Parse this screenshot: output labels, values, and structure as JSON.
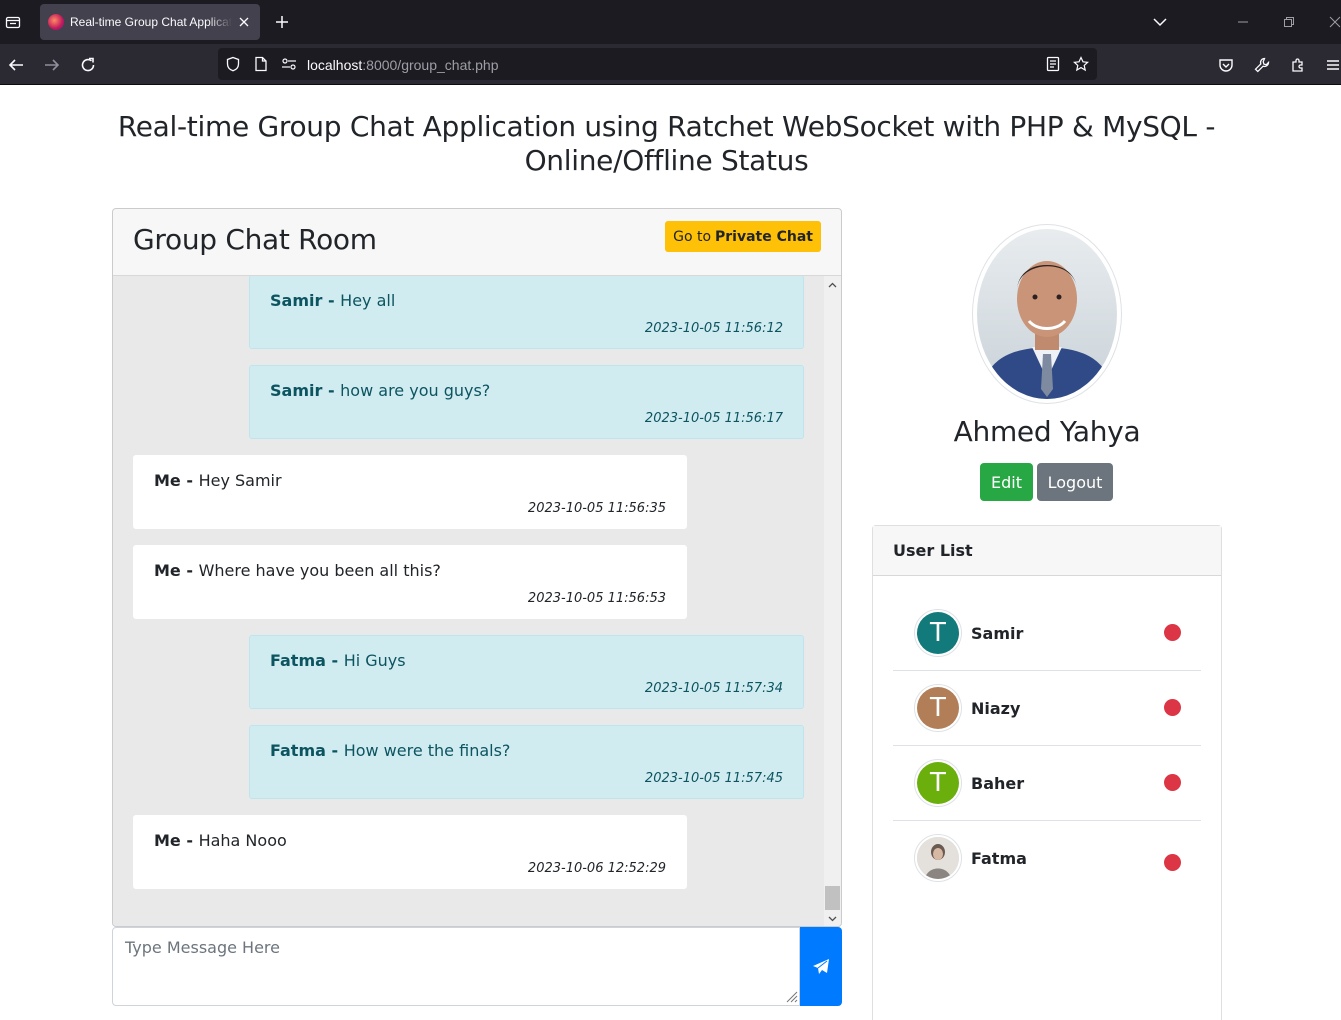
{
  "browser": {
    "tab_title": "Real-time Group Chat Application using Ratchet WebSocket",
    "url_host": "localhost",
    "url_rest": ":8000/group_chat.php"
  },
  "page": {
    "title_line1": "Real-time Group Chat Application using Ratchet WebSocket with PHP & MySQL -",
    "title_line2": "Online/Offline Status"
  },
  "chat": {
    "title": "Group Chat Room",
    "private_btn_prefix": "Go to",
    "private_btn_bold": "Private Chat",
    "messages": [
      {
        "sender": "Samir",
        "text": "Hey all",
        "time": "2023-10-05 11:56:12",
        "mine": false
      },
      {
        "sender": "Samir",
        "text": "how are you guys?",
        "time": "2023-10-05 11:56:17",
        "mine": false
      },
      {
        "sender": "Me",
        "text": "Hey Samir",
        "time": "2023-10-05 11:56:35",
        "mine": true
      },
      {
        "sender": "Me",
        "text": "Where have you been all this?",
        "time": "2023-10-05 11:56:53",
        "mine": true
      },
      {
        "sender": "Fatma",
        "text": "Hi Guys",
        "time": "2023-10-05 11:57:34",
        "mine": false
      },
      {
        "sender": "Fatma",
        "text": "How were the finals?",
        "time": "2023-10-05 11:57:45",
        "mine": false
      },
      {
        "sender": "Me",
        "text": "Haha Nooo",
        "time": "2023-10-06 12:52:29",
        "mine": true
      }
    ],
    "separator": " - ",
    "input_placeholder": "Type Message Here"
  },
  "profile": {
    "name": "Ahmed Yahya",
    "edit_label": "Edit",
    "logout_label": "Logout"
  },
  "users": {
    "header": "User List",
    "list": [
      {
        "name": "Samir",
        "initial": "T",
        "avatar_color": "#127a7a",
        "status": "offline"
      },
      {
        "name": "Niazy",
        "initial": "T",
        "avatar_color": "#b17e57",
        "status": "offline"
      },
      {
        "name": "Baher",
        "initial": "T",
        "avatar_color": "#6aaf0c",
        "status": "offline"
      },
      {
        "name": "Fatma",
        "initial": "",
        "avatar_color": "#d9d4cf",
        "status": "offline"
      }
    ]
  },
  "colors": {
    "offline_dot": "#dc3545",
    "other_msg_bg": "#d1ecf1",
    "send_button": "#007bff",
    "private_button": "#ffc107"
  }
}
